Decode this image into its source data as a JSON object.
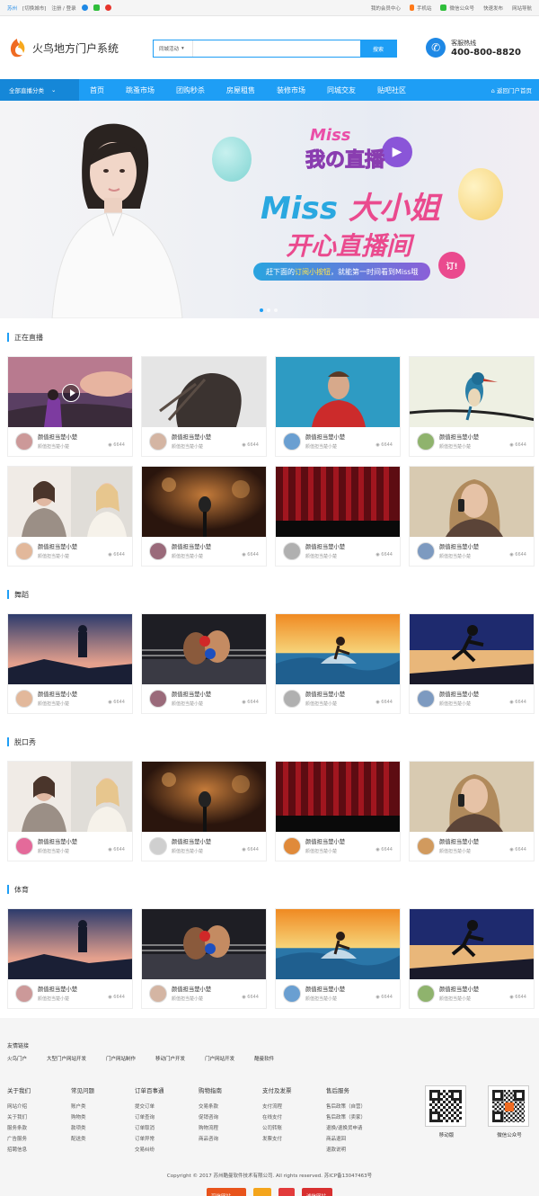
{
  "topbar": {
    "city": "苏州",
    "switch_city": "[切换城市]",
    "login": "注册 / 登录",
    "member": "我的会员中心",
    "mobile": "手机站",
    "wechat": "微信公众号",
    "publish": "快速发布",
    "site_nav": "网站导航"
  },
  "header": {
    "site_name": "火鸟地方门户系统",
    "search_select": "同城活动",
    "search_placeholder": "",
    "search_button": "搜索",
    "hotline_label": "客服热线",
    "hotline_number": "400-800-8820"
  },
  "nav": {
    "category": "全部直播分类",
    "items": [
      "首页",
      "跳蚤市场",
      "团购秒杀",
      "房屋租售",
      "装修市场",
      "同城交友",
      "贴吧社区"
    ],
    "back": "返回门户首页"
  },
  "banner": {
    "miss_small": "Miss",
    "live_small": "我の直播",
    "headline_a": "Miss",
    "headline_b": "大小姐",
    "headline_2": "开心直播间",
    "slogan_a": "赶下面的",
    "slogan_b": "订阅小按钮",
    "slogan_c": "，就能第一时间看到Miss哦",
    "subscribe": "订!"
  },
  "sections": [
    {
      "title": "正在直播",
      "cards": [
        {
          "name": "颜值担当楚小楚",
          "sub": "颜值担当楚小楚",
          "views": "6644",
          "art": "sunset-girl",
          "play": true
        },
        {
          "name": "颜值担当楚小楚",
          "sub": "颜值担当楚小楚",
          "views": "6644",
          "art": "hair-girl"
        },
        {
          "name": "颜值担当楚小楚",
          "sub": "颜值担当楚小楚",
          "views": "6644",
          "art": "man-red"
        },
        {
          "name": "颜值担当楚小楚",
          "sub": "颜值担当楚小楚",
          "views": "6644",
          "art": "bird"
        },
        {
          "name": "颜值担当楚小楚",
          "sub": "颜值担当楚小楚",
          "views": "6644",
          "art": "two-women"
        },
        {
          "name": "颜值担当楚小楚",
          "sub": "颜值担当楚小楚",
          "views": "6644",
          "art": "microphone"
        },
        {
          "name": "颜值担当楚小楚",
          "sub": "颜值担当楚小楚",
          "views": "6644",
          "art": "curtain"
        },
        {
          "name": "颜值担当楚小楚",
          "sub": "颜值担当楚小楚",
          "views": "6644",
          "art": "phone-woman"
        }
      ]
    },
    {
      "title": "舞蹈",
      "cards": [
        {
          "name": "颜值担当楚小楚",
          "sub": "颜值担当楚小楚",
          "views": "6644",
          "art": "hill-man"
        },
        {
          "name": "颜值担当楚小楚",
          "sub": "颜值担当楚小楚",
          "views": "6644",
          "art": "boxing"
        },
        {
          "name": "颜值担当楚小楚",
          "sub": "颜值担当楚小楚",
          "views": "6644",
          "art": "surf"
        },
        {
          "name": "颜值担当楚小楚",
          "sub": "颜值担当楚小楚",
          "views": "6644",
          "art": "skate"
        }
      ]
    },
    {
      "title": "脱口秀",
      "cards": [
        {
          "name": "颜值担当楚小楚",
          "sub": "颜值担当楚小楚",
          "views": "6644",
          "art": "two-women"
        },
        {
          "name": "颜值担当楚小楚",
          "sub": "颜值担当楚小楚",
          "views": "6644",
          "art": "microphone"
        },
        {
          "name": "颜值担当楚小楚",
          "sub": "颜值担当楚小楚",
          "views": "6644",
          "art": "curtain"
        },
        {
          "name": "颜值担当楚小楚",
          "sub": "颜值担当楚小楚",
          "views": "6644",
          "art": "phone-woman"
        }
      ]
    },
    {
      "title": "体育",
      "cards": [
        {
          "name": "颜值担当楚小楚",
          "sub": "颜值担当楚小楚",
          "views": "6644",
          "art": "hill-man"
        },
        {
          "name": "颜值担当楚小楚",
          "sub": "颜值担当楚小楚",
          "views": "6644",
          "art": "boxing"
        },
        {
          "name": "颜值担当楚小楚",
          "sub": "颜值担当楚小楚",
          "views": "6644",
          "art": "surf"
        },
        {
          "name": "颜值担当楚小楚",
          "sub": "颜值担当楚小楚",
          "views": "6644",
          "art": "skate"
        }
      ]
    }
  ],
  "footer": {
    "links_title": "友情链接",
    "links": [
      "火鸟门户",
      "大型门户网站开发",
      "门户网站制作",
      "移动门户开发",
      "门户网站开发",
      "酷曼软件"
    ],
    "columns": [
      {
        "title": "关于我们",
        "items": [
          "网站介绍",
          "关于我们",
          "服务条款",
          "广告服务",
          "招聘信息"
        ]
      },
      {
        "title": "常见问题",
        "items": [
          "账户类",
          "购物类",
          "款项类",
          "配送类"
        ]
      },
      {
        "title": "订单百事通",
        "items": [
          "提交订单",
          "订单查询",
          "订单取消",
          "订单异常",
          "交易纠纷"
        ]
      },
      {
        "title": "购物指南",
        "items": [
          "交易条款",
          "促销咨询",
          "购物流程",
          "商品咨询"
        ]
      },
      {
        "title": "支付及发票",
        "items": [
          "支付流程",
          "在线支付",
          "公司转账",
          "发票支付"
        ]
      },
      {
        "title": "售后服务",
        "items": [
          "售后政策（自营）",
          "售后政策（卖家）",
          "退换/退换货申请",
          "商品退回",
          "退款说明"
        ]
      }
    ],
    "qr_mobile": "移动版",
    "qr_wechat": "微信公众号",
    "copyright": "Copyright © 2017 苏州酷曼软件技术有限公司. All rights reserved.   苏ICP备13047463号",
    "badges": [
      "可信网站",
      "",
      "",
      "诚信网站"
    ]
  }
}
